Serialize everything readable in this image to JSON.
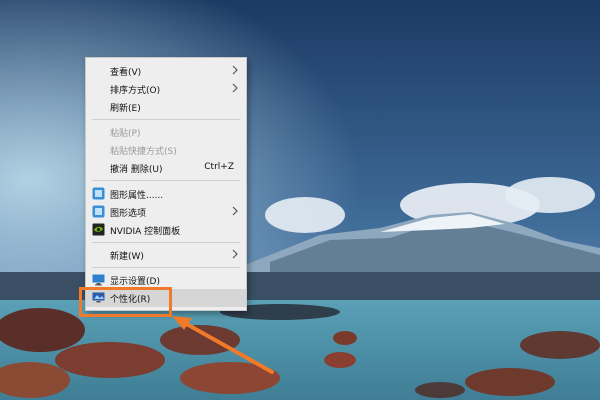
{
  "desktop": {
    "name": "Windows desktop",
    "background_colors": {
      "sky_top": "#1d3d66",
      "sky_bottom": "#5f88b0",
      "water": "#64a6b8",
      "lava": "#7a3a2a"
    }
  },
  "context_menu": {
    "items": [
      {
        "label": "查看(V)",
        "submenu": true,
        "enabled": true
      },
      {
        "label": "排序方式(O)",
        "submenu": true,
        "enabled": true
      },
      {
        "label": "刷新(E)",
        "enabled": true
      },
      {
        "label": "粘贴(P)",
        "enabled": false
      },
      {
        "label": "粘贴快捷方式(S)",
        "enabled": false
      },
      {
        "label": "撤消 删除(U)",
        "shortcut": "Ctrl+Z",
        "enabled": true
      },
      {
        "label": "图形属性......",
        "icon": "intel-graphics-icon",
        "enabled": true
      },
      {
        "label": "图形选项",
        "icon": "intel-graphics-icon",
        "submenu": true,
        "enabled": true
      },
      {
        "label": "NVIDIA 控制面板",
        "icon": "nvidia-icon",
        "enabled": true
      },
      {
        "label": "新建(W)",
        "submenu": true,
        "enabled": true
      },
      {
        "label": "显示设置(D)",
        "icon": "display-settings-icon",
        "enabled": true
      },
      {
        "label": "个性化(R)",
        "icon": "personalize-icon",
        "enabled": true,
        "highlighted": true
      }
    ]
  },
  "annotation": {
    "highlight_color": "#f07a2a",
    "target": "个性化(R)"
  }
}
